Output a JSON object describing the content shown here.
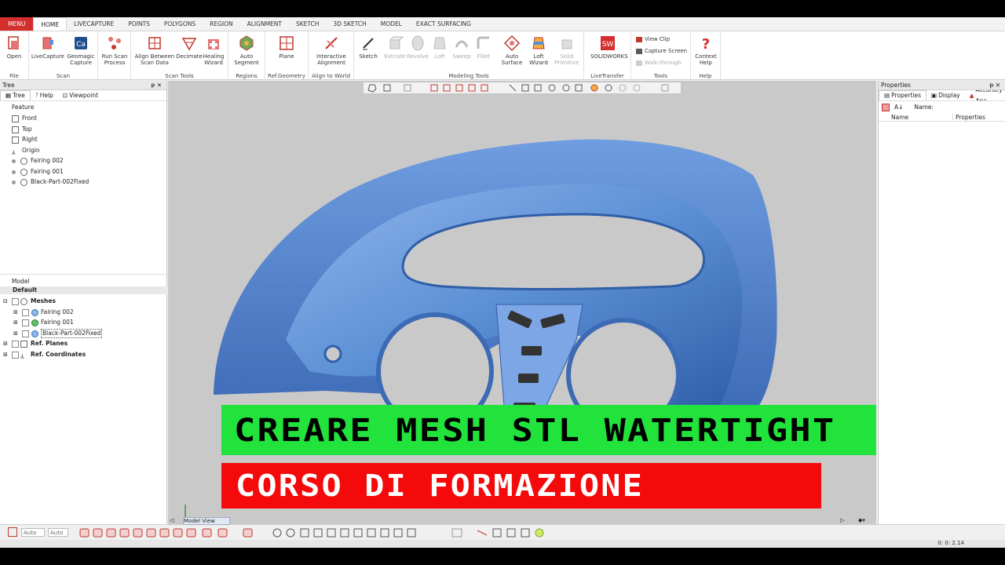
{
  "ribbon_tabs": [
    {
      "label": "MENU"
    },
    {
      "label": "HOME"
    },
    {
      "label": "LIVECAPTURE"
    },
    {
      "label": "POINTS"
    },
    {
      "label": "POLYGONS"
    },
    {
      "label": "REGION"
    },
    {
      "label": "ALIGNMENT"
    },
    {
      "label": "SKETCH"
    },
    {
      "label": "3D SKETCH"
    },
    {
      "label": "MODEL"
    },
    {
      "label": "EXACT SURFACING"
    }
  ],
  "ribbon": {
    "file": {
      "label": "File",
      "open": "Open"
    },
    "scan": {
      "label": "Scan",
      "livecapture": "LiveCapture",
      "geomagic1": "Geomagic",
      "geomagic2": "Capture",
      "runscan1": "Run Scan",
      "runscan2": "Process"
    },
    "scantools": {
      "label": "Scan Tools",
      "align1": "Align Between",
      "align2": "Scan Data",
      "decimate": "Decimate",
      "healing1": "Healing",
      "healing2": "Wizard"
    },
    "regions": {
      "label": "Regions",
      "auto1": "Auto",
      "auto2": "Segment"
    },
    "refgeo": {
      "label": "Ref.Geometry",
      "plane": "Plane"
    },
    "align": {
      "label": "Align to World",
      "inter1": "Interactive",
      "inter2": "Alignment"
    },
    "modeling": {
      "label": "Modeling Tools",
      "sketch": "Sketch",
      "extrude": "Extrude",
      "revolve": "Revolve",
      "loft": "Loft",
      "sweep": "Sweep",
      "fillet": "Fillet",
      "autosurf1": "Auto",
      "autosurf2": "Surface",
      "loftwiz1": "Loft",
      "loftwiz2": "Wizard",
      "solid1": "Solid",
      "solid2": "Primitive"
    },
    "live": {
      "label": "LiveTransfer",
      "solidworks": "SOLIDWORKS"
    },
    "tools": {
      "label": "Tools",
      "viewclip": "View Clip",
      "capture": "Capture Screen",
      "walk": "Walk-through"
    },
    "help": {
      "label": "Help",
      "ctx1": "Context",
      "ctx2": "Help"
    }
  },
  "tree_panel": {
    "title": "Tree",
    "tabs": [
      "Tree",
      "Help",
      "Viewpoint"
    ],
    "feature_header": "Feature",
    "features": [
      "Front",
      "Top",
      "Right",
      "Origin",
      "Fairing 002",
      "Fairing 001",
      "Black-Part-002Fixed"
    ],
    "model_header": "Model",
    "model_default": "Default",
    "meshes": "Meshes",
    "mesh_items": [
      "Fairing 002",
      "Fairing 001",
      "Black-Part-002Fixed"
    ],
    "ref_planes": "Ref. Planes",
    "ref_coords": "Ref. Coordinates"
  },
  "properties_panel": {
    "title": "Properties",
    "tabs": [
      "Properties",
      "Display",
      "Accuracy Ana"
    ],
    "name_label": "Name:",
    "col_name": "Name",
    "col_props": "Properties"
  },
  "viewport": {
    "view_tab": "Model View",
    "banner_top": "CREARE MESH STL WATERTIGHT",
    "banner_bottom": "CORSO DI FORMAZIONE",
    "banner_top_color": "#21e33c",
    "banner_bottom_color": "#f40a0a"
  },
  "bottom": {
    "combo1": "Auto",
    "combo2": "Auto",
    "timer": "0: 0: 2.14"
  },
  "colors": {
    "accent": "#d32f2f",
    "mesh": "#5b8fd4"
  }
}
